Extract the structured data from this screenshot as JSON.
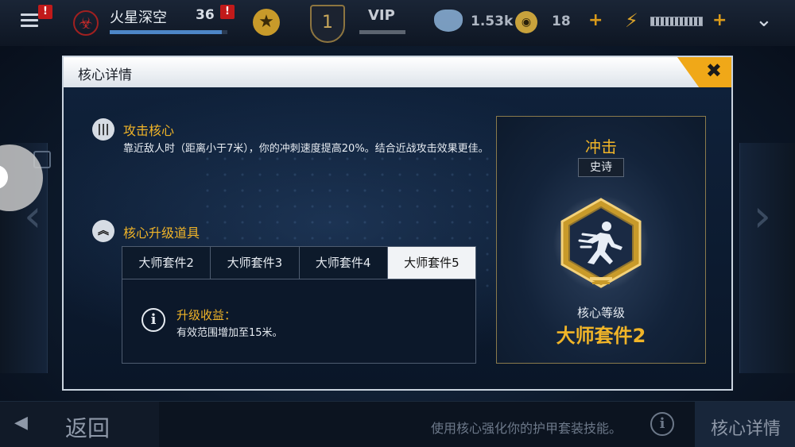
{
  "topbar": {
    "player_name": "火星深空",
    "player_level": "36",
    "alert_badge": "!",
    "rank_number": "1",
    "vip_label": "VIP",
    "credits": "1.53k",
    "gold": "18",
    "plus": "+",
    "xp_progress": 0.95
  },
  "modal": {
    "title": "核心详情",
    "close_label": "✖",
    "attack_core": {
      "title": "攻击核心",
      "description": "靠近敌人时（距离小于7米），你的冲刺速度提高20%。结合近战攻击效果更佳。"
    },
    "upgrade": {
      "title": "核心升级道具",
      "tabs": [
        "大师套件2",
        "大师套件3",
        "大师套件4",
        "大师套件5"
      ],
      "active_tab": 3,
      "benefit_title": "升级收益：",
      "benefit_text": "有效范围增加至15米。"
    },
    "card": {
      "name": "冲击",
      "rarity": "史诗",
      "level_label": "核心等级",
      "level_value": "大师套件2"
    }
  },
  "bottombar": {
    "back_label": "返回",
    "hint": "使用核心强化你的护甲套装技能。",
    "core_detail_label": "核心详情"
  },
  "colors": {
    "accent_gold": "#f0b428",
    "close_orange": "#f0a818",
    "alert_red": "#c11a1a"
  },
  "icons": [
    "menu-icon",
    "hazard-icon",
    "star-icon",
    "rank-shield-icon",
    "gem-icon",
    "coin-icon",
    "bolt-icon",
    "chevron-down-icon",
    "close-icon",
    "ammo-icon",
    "double-chevron-up-icon",
    "info-icon",
    "sprint-emblem-icon",
    "arrow-left-icon"
  ]
}
